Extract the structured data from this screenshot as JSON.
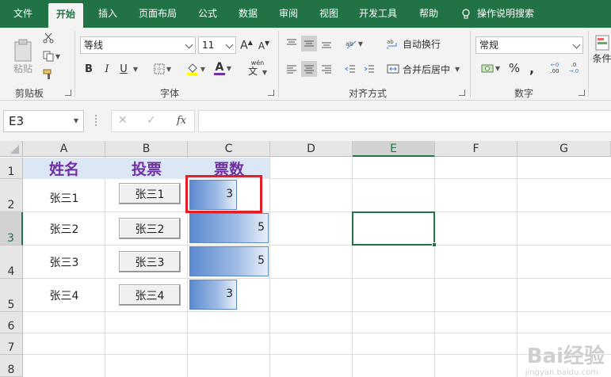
{
  "ribbon_tabs": [
    "文件",
    "开始",
    "插入",
    "页面布局",
    "公式",
    "数据",
    "审阅",
    "视图",
    "开发工具",
    "帮助"
  ],
  "tell_me": "操作说明搜索",
  "clipboard": {
    "paste_label": "粘贴",
    "group_label": "剪贴板"
  },
  "font": {
    "family": "等线",
    "size": "11",
    "bold": "B",
    "italic": "I",
    "underline": "U",
    "color_glyph": "A",
    "phonetic": "wén",
    "group_label": "字体"
  },
  "alignment": {
    "wrap_label": "自动换行",
    "merge_label": "合并后居中",
    "group_label": "对齐方式"
  },
  "number": {
    "format": "常规",
    "percent": "%",
    "comma": ",",
    "inc_decimal": ".00",
    "dec_decimal": ".0",
    "group_label": "数字"
  },
  "styles": {
    "partial_label": "条件"
  },
  "formula_bar": {
    "name_box": "E3",
    "cancel": "✕",
    "enter": "✓",
    "fx": "fx",
    "formula": ""
  },
  "columns": [
    "A",
    "B",
    "C",
    "D",
    "E",
    "F",
    "G"
  ],
  "rows": [
    "1",
    "2",
    "3",
    "4",
    "5",
    "6",
    "7",
    "8"
  ],
  "selected_cell": {
    "column": "E",
    "row": "3"
  },
  "sheet": {
    "headers": [
      "姓名",
      "投票",
      "票数"
    ],
    "records": [
      {
        "name": "张三1",
        "button": "张三1",
        "votes": 3
      },
      {
        "name": "张三2",
        "button": "张三2",
        "votes": 5
      },
      {
        "name": "张三3",
        "button": "张三3",
        "votes": 5
      },
      {
        "name": "张三4",
        "button": "张三4",
        "votes": 3
      }
    ],
    "votes_max": 5
  },
  "watermark": {
    "text": "Bai经验",
    "url": "jingyan.baidu.com"
  },
  "colors": {
    "brand": "#217346",
    "header_text": "#7030a0",
    "header_fill": "#dbe7f4",
    "bar": "#5b8ad0",
    "highlight": "#e41e26"
  }
}
